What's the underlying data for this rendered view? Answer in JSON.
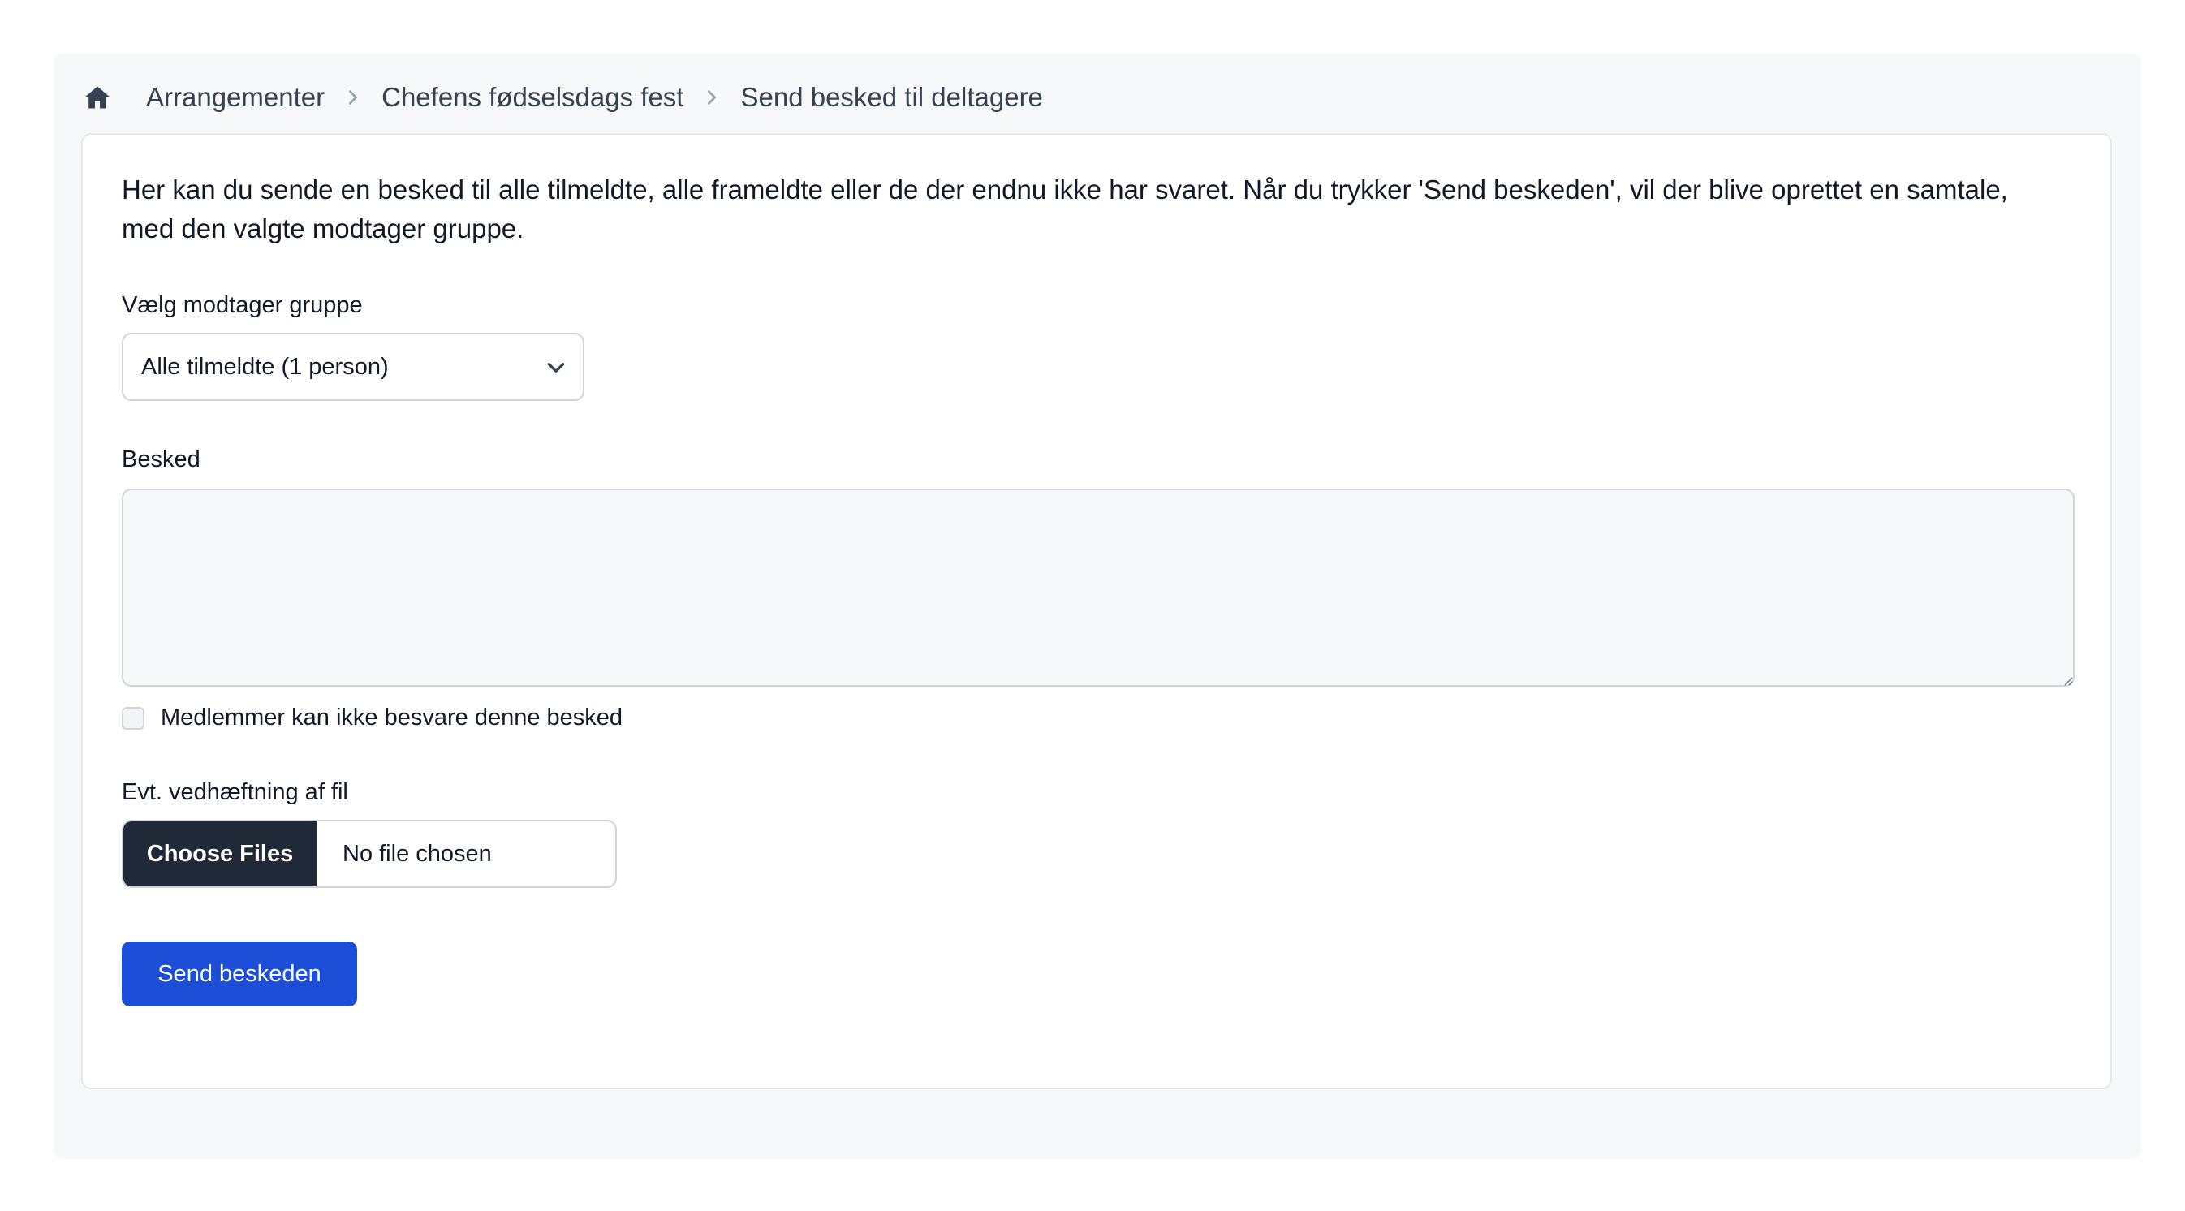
{
  "breadcrumb": {
    "home_icon": "home-icon",
    "items": [
      {
        "label": "Arrangementer"
      },
      {
        "label": "Chefens fødselsdags fest"
      },
      {
        "label": "Send besked til deltagere"
      }
    ]
  },
  "form": {
    "intro_text": "Her kan du sende en besked til alle tilmeldte, alle frameldte eller de der endnu ikke har svaret. Når du trykker 'Send beskeden', vil der blive oprettet en samtale, med den valgte modtager gruppe.",
    "recipient_label": "Vælg modtager gruppe",
    "recipient_selected": "Alle tilmeldte (1 person)",
    "message_label": "Besked",
    "message_value": "",
    "no_reply_checkbox_label": "Medlemmer kan ikke besvare denne besked",
    "no_reply_checked": false,
    "attachment_label": "Evt. vedhæftning af fil",
    "choose_files_label": "Choose Files",
    "file_status": "No file chosen",
    "submit_label": "Send beskeden"
  },
  "colors": {
    "primary_button": "#1d4ed8",
    "file_button": "#1f2937",
    "page_background": "#f7f8fa"
  }
}
